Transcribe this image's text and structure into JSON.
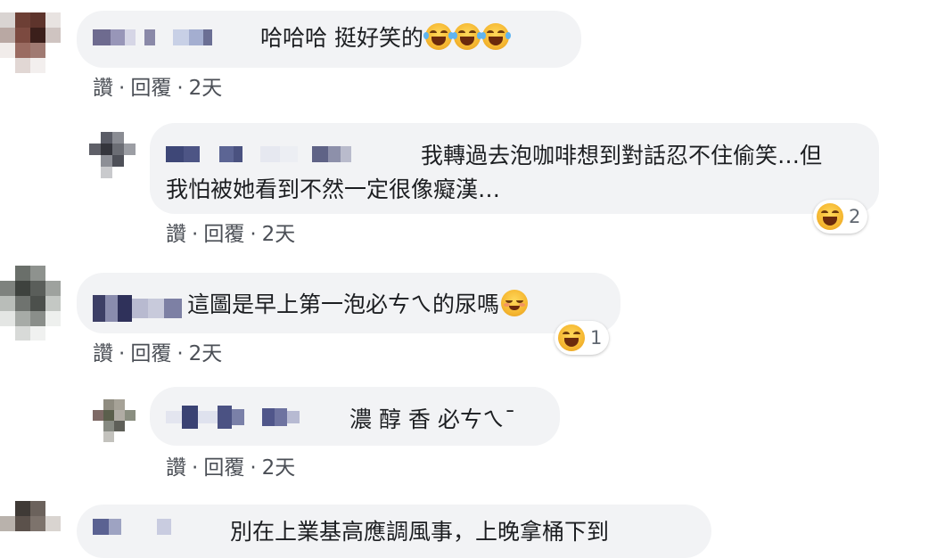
{
  "comments": [
    {
      "id": "c1",
      "text": "哈哈哈 挺好笑的",
      "emoji_count": 3,
      "emoji_kind": "rolling-laughing-emoji",
      "like": "讚",
      "reply": "回覆",
      "time": "2天"
    },
    {
      "id": "c2",
      "text": "我轉過去泡咖啡想到對話忍不住偷笑…但我怕被她看到不然一定很像癡漢…",
      "like": "讚",
      "reply": "回覆",
      "time": "2天",
      "reaction_count": "2",
      "reaction_kind": "laughing-emoji"
    },
    {
      "id": "c3",
      "text": "這圖是早上第一泡必ㄘㄟ的尿嗎",
      "emoji_kind": "blush-emoji",
      "like": "讚",
      "reply": "回覆",
      "time": "2天",
      "reaction_count": "1",
      "reaction_kind": "laughing-emoji"
    },
    {
      "id": "c4",
      "text": "濃 醇 香 必ㄘㄟˉ",
      "like": "讚",
      "reply": "回覆",
      "time": "2天"
    },
    {
      "id": "c5",
      "text": "別在上業基高應調風事，上晚拿桶下到"
    }
  ],
  "colors": {
    "bubble": "#f2f3f5",
    "text": "#1c1e21",
    "meta": "#4b4f56"
  }
}
